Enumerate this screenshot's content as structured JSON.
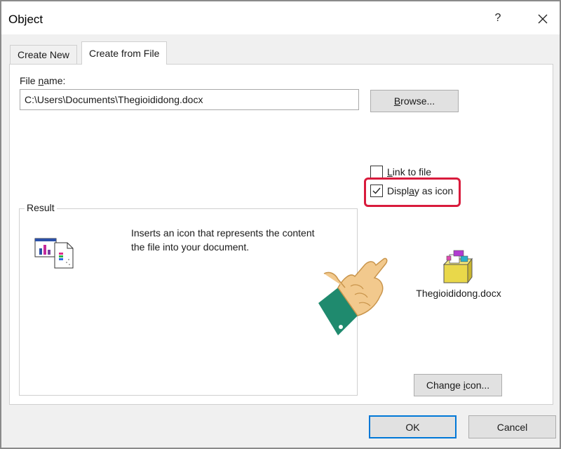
{
  "window": {
    "title": "Object",
    "help_label": "?"
  },
  "tabs": [
    {
      "label": "Create New",
      "active": false
    },
    {
      "label": "Create from File",
      "active": true
    }
  ],
  "file_name": {
    "label": "File name:",
    "value": "C:\\Users\\Documents\\Thegioididong.docx"
  },
  "buttons": {
    "browse": "Browse...",
    "change_icon": "Change icon...",
    "ok": "OK",
    "cancel": "Cancel"
  },
  "options": {
    "link_to_file": {
      "label": "Link to file",
      "checked": false
    },
    "display_as_icon": {
      "label": "Display as icon",
      "checked": true
    }
  },
  "result": {
    "legend": "Result",
    "line1": "Inserts an icon that represents the content",
    "line2": "the file into your document."
  },
  "icon_preview": {
    "caption": "Thegioididong.docx",
    "icon": "package-icon"
  },
  "colors": {
    "highlight": "#d91b3c",
    "ok_border": "#0078d7",
    "hand_skin": "#f2c98d",
    "cuff": "#1f8a6e"
  }
}
